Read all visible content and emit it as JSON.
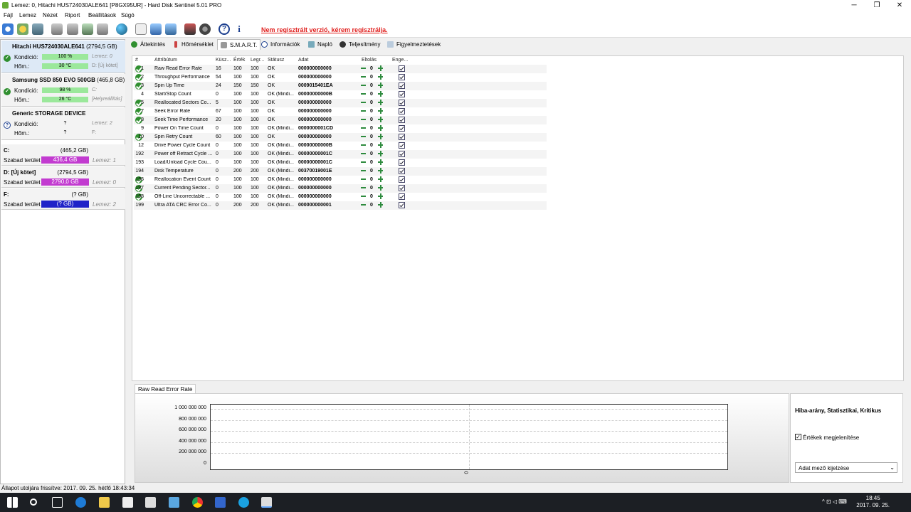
{
  "window": {
    "title": "Lemez: 0, Hitachi HUS724030ALE641 [P8GX95UR]  -  Hard Disk Sentinel 5.01 PRO"
  },
  "menu": [
    "Fájl",
    "Lemez",
    "Nézet",
    "Riport",
    "Beállítások",
    "Súgó"
  ],
  "toolbar": {
    "register_link": "Nem regisztrált verzió, kérem regisztrálja."
  },
  "disks": [
    {
      "name": "Hitachi HUS724030ALE641",
      "capacity": "(2794,5 GB)",
      "cond_label": "Kondíció:",
      "cond_value": "100 %",
      "cond_side": "Lemez: 0",
      "temp_label": "Hőm.:",
      "temp_value": "30 °C",
      "temp_side": "D: [Új kötet]",
      "status": "ok",
      "cond_color": "#9be89b",
      "temp_color": "#9be89b"
    },
    {
      "name": "Samsung SSD 850 EVO 500GB",
      "capacity": "(465,8 GB)",
      "cond_label": "Kondíció:",
      "cond_value": "98 %",
      "cond_side": "C:",
      "temp_label": "Hőm.:",
      "temp_value": "26 °C",
      "temp_side": "[Helyreállítás]",
      "status": "ok",
      "cond_color": "#9be89b",
      "temp_color": "#9be89b"
    },
    {
      "name": "Generic STORAGE DEVICE",
      "capacity": "",
      "cond_label": "Kondíció:",
      "cond_value": "?",
      "cond_side": "Lemez: 2",
      "temp_label": "Hőm.:",
      "temp_value": "?",
      "temp_side": "F:",
      "status": "unknown",
      "cond_color": "#f3f3f3",
      "temp_color": "#f3f3f3"
    }
  ],
  "partitions": [
    {
      "name": "C:",
      "capacity": "(465,2 GB)",
      "free_label": "Szabad terület",
      "free_value": "436,4 GB",
      "disk": "Lemez: 1",
      "color": "#c23bd0"
    },
    {
      "name": "D: [Új kötet]",
      "capacity": "(2794,5 GB)",
      "free_label": "Szabad terület",
      "free_value": "2790,0 GB",
      "disk": "Lemez: 0",
      "color": "#c23bd0"
    },
    {
      "name": "F:",
      "capacity": "(? GB)",
      "free_label": "Szabad terület",
      "free_value": "(? GB)",
      "disk": "Lemez: 2",
      "color": "#1f22c8"
    }
  ],
  "tabs": [
    "Áttekintés",
    "Hőmérséklet",
    "S.M.A.R.T.",
    "Információk",
    "Napló",
    "Teljesítmény",
    "Figyelmeztetések"
  ],
  "active_tab": "S.M.A.R.T.",
  "smart": {
    "headers": [
      "#",
      "Attribútum",
      "Küsz...",
      "Érték",
      "Legr...",
      "Státusz",
      "Adat",
      "Eltolás",
      "Enge..."
    ],
    "rows": [
      {
        "ok": true,
        "id": "1",
        "name": "Raw Read Error Rate",
        "thr": "16",
        "val": "100",
        "worst": "100",
        "status": "OK",
        "data": "000000000000",
        "offset": "0"
      },
      {
        "ok": true,
        "id": "2",
        "name": "Throughput Performance",
        "thr": "54",
        "val": "100",
        "worst": "100",
        "status": "OK",
        "data": "000000000000",
        "offset": "0"
      },
      {
        "ok": true,
        "id": "3",
        "name": "Spin Up Time",
        "thr": "24",
        "val": "150",
        "worst": "150",
        "status": "OK",
        "data": "0009015401EA",
        "offset": "0"
      },
      {
        "ok": false,
        "id": "4",
        "name": "Start/Stop Count",
        "thr": "0",
        "val": "100",
        "worst": "100",
        "status": "OK (Mindi...",
        "data": "00000000000B",
        "offset": "0"
      },
      {
        "ok": true,
        "id": "5",
        "name": "Reallocated Sectors Co...",
        "thr": "5",
        "val": "100",
        "worst": "100",
        "status": "OK",
        "data": "000000000000",
        "offset": "0"
      },
      {
        "ok": true,
        "id": "7",
        "name": "Seek Error Rate",
        "thr": "67",
        "val": "100",
        "worst": "100",
        "status": "OK",
        "data": "000000000000",
        "offset": "0"
      },
      {
        "ok": true,
        "id": "8",
        "name": "Seek Time Performance",
        "thr": "20",
        "val": "100",
        "worst": "100",
        "status": "OK",
        "data": "000000000000",
        "offset": "0"
      },
      {
        "ok": false,
        "id": "9",
        "name": "Power On Time Count",
        "thr": "0",
        "val": "100",
        "worst": "100",
        "status": "OK (Mindi...",
        "data": "0000000001CD",
        "offset": "0"
      },
      {
        "ok": true,
        "id": "10",
        "name": "Spin Retry Count",
        "thr": "60",
        "val": "100",
        "worst": "100",
        "status": "OK",
        "data": "000000000000",
        "offset": "0"
      },
      {
        "ok": false,
        "id": "12",
        "name": "Drive Power Cycle Count",
        "thr": "0",
        "val": "100",
        "worst": "100",
        "status": "OK (Mindi...",
        "data": "00000000000B",
        "offset": "0"
      },
      {
        "ok": false,
        "id": "192",
        "name": "Power off Retract Cycle ...",
        "thr": "0",
        "val": "100",
        "worst": "100",
        "status": "OK (Mindi...",
        "data": "00000000001C",
        "offset": "0"
      },
      {
        "ok": false,
        "id": "193",
        "name": "Load/Unload Cycle Cou...",
        "thr": "0",
        "val": "100",
        "worst": "100",
        "status": "OK (Mindi...",
        "data": "00000000001C",
        "offset": "0"
      },
      {
        "ok": false,
        "id": "194",
        "name": "Disk Temperature",
        "thr": "0",
        "val": "200",
        "worst": "200",
        "status": "OK (Mindi...",
        "data": "00370019001E",
        "offset": "0"
      },
      {
        "ok": true,
        "id": "196",
        "name": "Reallocation Event Count",
        "thr": "0",
        "val": "100",
        "worst": "100",
        "status": "OK (Mindi...",
        "data": "000000000000",
        "offset": "0"
      },
      {
        "ok": true,
        "id": "197",
        "name": "Current Pending Sector...",
        "thr": "0",
        "val": "100",
        "worst": "100",
        "status": "OK (Mindi...",
        "data": "000000000000",
        "offset": "0"
      },
      {
        "ok": true,
        "id": "198",
        "name": "Off-Line Uncorrectable ...",
        "thr": "0",
        "val": "100",
        "worst": "100",
        "status": "OK (Mindi...",
        "data": "000000000000",
        "offset": "0"
      },
      {
        "ok": false,
        "id": "199",
        "name": "Ultra ATA CRC Error Co...",
        "thr": "0",
        "val": "200",
        "worst": "200",
        "status": "OK (Mindi...",
        "data": "000000000001",
        "offset": "0"
      }
    ]
  },
  "chart": {
    "tab_label": "Raw Read Error Rate",
    "y_ticks": [
      "1 000 000 000",
      "800 000 000",
      "600 000 000",
      "400 000 000",
      "200 000 000",
      "0"
    ],
    "x_label": "0",
    "panel_title": "Hiba-arány, Statisztikai, Kritikus",
    "checkbox_label": "Értékek megjelenítése",
    "select_value": "Adat mező kijelzése"
  },
  "status_bar": "Állapot utoljára frissítve: 2017. 09. 25. hétfő 18:43:34",
  "clock": {
    "time": "18:45",
    "date": "2017. 09. 25."
  }
}
